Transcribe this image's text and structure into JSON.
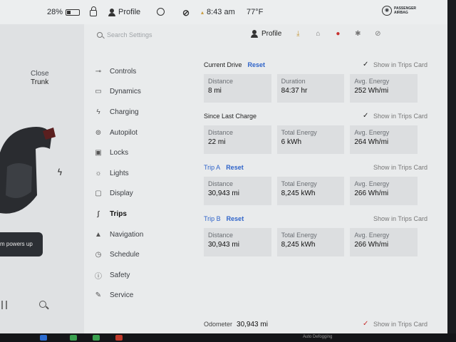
{
  "status_bar": {
    "battery": "28%",
    "profile": "Profile",
    "time": "8:43 am",
    "temperature": "77°F",
    "airbag_text": "PASSENGER AIRBAG"
  },
  "car_panel": {
    "trunk_line1": "Close",
    "trunk_line2": "Trunk",
    "toast_text": "m powers up"
  },
  "settings_header": {
    "search_placeholder": "Search Settings",
    "profile": "Profile"
  },
  "nav": {
    "items": [
      {
        "label": "Controls",
        "icon": "toggle-icon"
      },
      {
        "label": "Dynamics",
        "icon": "car-icon"
      },
      {
        "label": "Charging",
        "icon": "bolt-icon"
      },
      {
        "label": "Autopilot",
        "icon": "steering-wheel-icon"
      },
      {
        "label": "Locks",
        "icon": "lock-icon"
      },
      {
        "label": "Lights",
        "icon": "lightbulb-icon"
      },
      {
        "label": "Display",
        "icon": "display-icon"
      },
      {
        "label": "Trips",
        "icon": "trips-icon"
      },
      {
        "label": "Navigation",
        "icon": "navigation-icon"
      },
      {
        "label": "Schedule",
        "icon": "clock-icon"
      },
      {
        "label": "Safety",
        "icon": "safety-icon"
      },
      {
        "label": "Service",
        "icon": "wrench-icon"
      }
    ]
  },
  "trips": {
    "current_drive": {
      "title": "Current Drive",
      "reset": "Reset",
      "show_label": "Show in Trips Card",
      "stats": [
        {
          "label": "Distance",
          "value": "8 mi"
        },
        {
          "label": "Duration",
          "value": "84:37 hr"
        },
        {
          "label": "Avg. Energy",
          "value": "252 Wh/mi"
        }
      ]
    },
    "since_charge": {
      "title": "Since Last Charge",
      "show_label": "Show in Trips Card",
      "stats": [
        {
          "label": "Distance",
          "value": "22 mi"
        },
        {
          "label": "Total Energy",
          "value": "6 kWh"
        },
        {
          "label": "Avg. Energy",
          "value": "264 Wh/mi"
        }
      ]
    },
    "trip_a": {
      "title": "Trip A",
      "reset": "Reset",
      "show_label": "Show in Trips Card",
      "stats": [
        {
          "label": "Distance",
          "value": "30,943 mi"
        },
        {
          "label": "Total Energy",
          "value": "8,245 kWh"
        },
        {
          "label": "Avg. Energy",
          "value": "266 Wh/mi"
        }
      ]
    },
    "trip_b": {
      "title": "Trip B",
      "reset": "Reset",
      "show_label": "Show in Trips Card",
      "stats": [
        {
          "label": "Distance",
          "value": "30,943 mi"
        },
        {
          "label": "Total Energy",
          "value": "8,245 kWh"
        },
        {
          "label": "Avg. Energy",
          "value": "266 Wh/mi"
        }
      ]
    },
    "odometer": {
      "label": "Odometer",
      "value": "30,943 mi"
    },
    "odometer_show_label": "Show in Trips Card"
  },
  "taskbar": {
    "label": "Auto Defogging"
  },
  "colors": {
    "accent": "#2e63c9",
    "checkmark_red": "#c7312f"
  }
}
